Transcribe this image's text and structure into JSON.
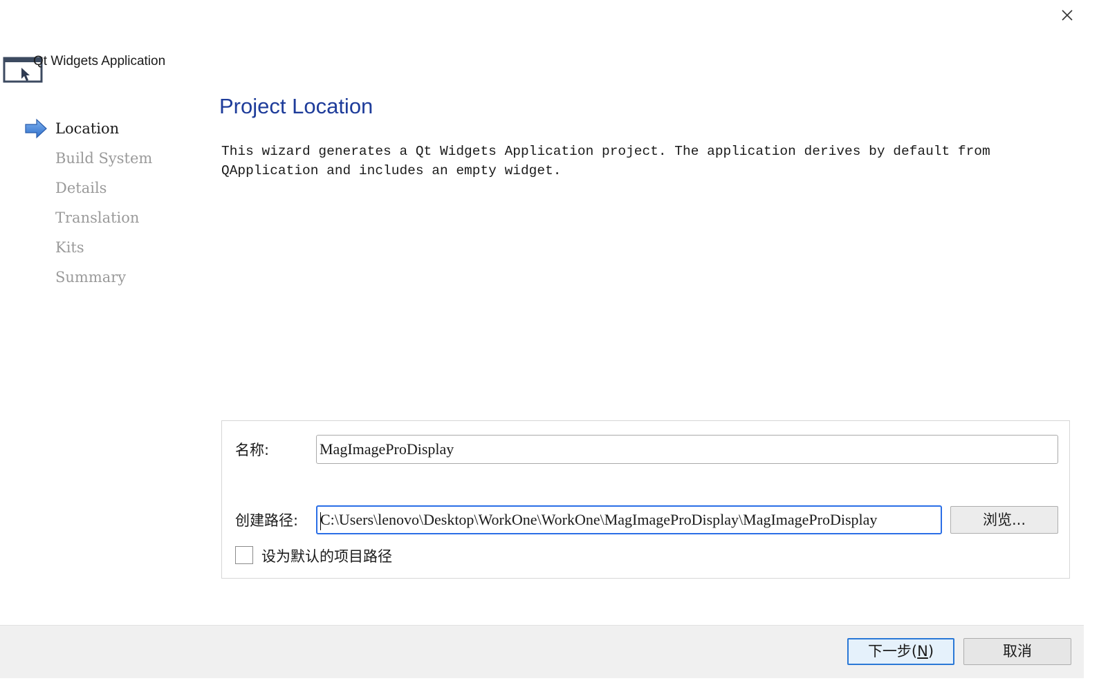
{
  "window": {
    "close_label": "×"
  },
  "header": {
    "title": "Qt Widgets Application",
    "icon": "qt-window-icon"
  },
  "sidebar": {
    "steps": [
      {
        "label": "Location",
        "active": true
      },
      {
        "label": "Build System",
        "active": false
      },
      {
        "label": "Details",
        "active": false
      },
      {
        "label": "Translation",
        "active": false
      },
      {
        "label": "Kits",
        "active": false
      },
      {
        "label": "Summary",
        "active": false
      }
    ],
    "active_icon": "arrow-right-icon"
  },
  "main": {
    "title": "Project Location",
    "description": "This wizard generates a Qt Widgets Application project. The application derives by default from QApplication and includes an empty widget."
  },
  "form": {
    "name_label": "名称:",
    "name_value": "MagImageProDisplay",
    "path_label": "创建路径:",
    "path_value": "C:\\Users\\lenovo\\Desktop\\WorkOne\\WorkOne\\MagImageProDisplay\\MagImageProDisplay",
    "browse_label": "浏览...",
    "default_path_label": "设为默认的项目路径",
    "default_path_checked": false
  },
  "footer": {
    "next_label_prefix": "下一步(",
    "next_mnemonic": "N",
    "next_label_suffix": ")",
    "cancel_label": "取消"
  },
  "colors": {
    "accent": "#1e3c9a",
    "focus_border": "#2a6ee6",
    "inactive_step": "#9a9a9a",
    "footer_bg": "#f0f0f0"
  }
}
